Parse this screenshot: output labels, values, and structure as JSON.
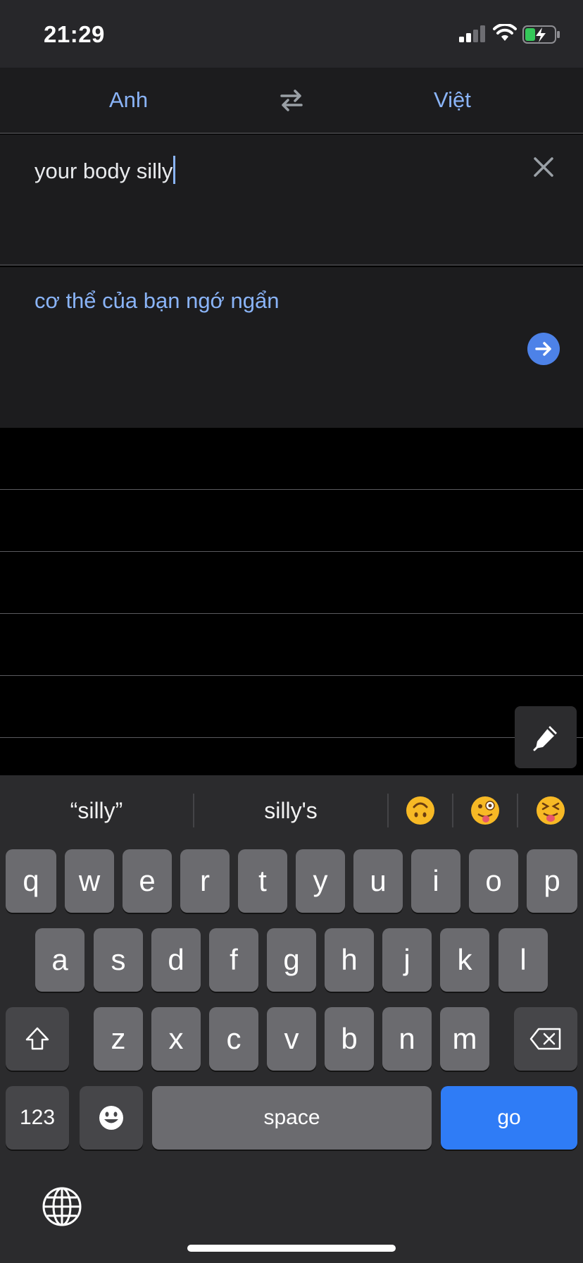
{
  "status_bar": {
    "time": "21:29"
  },
  "language_bar": {
    "source": "Anh",
    "target": "Việt"
  },
  "input": {
    "text": "your body silly"
  },
  "translation": {
    "text": "cơ thể của bạn ngớ ngẩn"
  },
  "suggestions": {
    "items": [
      "“silly”",
      "silly's"
    ],
    "emojis": [
      "upside-down-face-emoji",
      "winking-face-with-tongue-emoji",
      "squinting-face-with-tongue-emoji"
    ]
  },
  "keyboard": {
    "row1": [
      "q",
      "w",
      "e",
      "r",
      "t",
      "y",
      "u",
      "i",
      "o",
      "p"
    ],
    "row2": [
      "a",
      "s",
      "d",
      "f",
      "g",
      "h",
      "j",
      "k",
      "l"
    ],
    "row3": [
      "z",
      "x",
      "c",
      "v",
      "b",
      "n",
      "m"
    ],
    "numbers_label": "123",
    "space_label": "space",
    "go_label": "go"
  },
  "colors": {
    "accent": "#8ab4f8",
    "go_key": "#2f7cf6",
    "translate_button": "#4d82e8"
  }
}
